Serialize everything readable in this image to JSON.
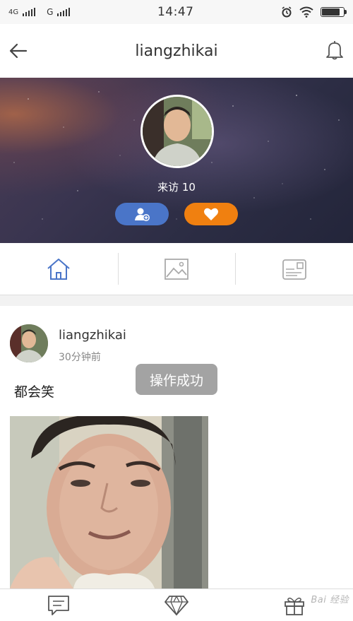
{
  "status_bar": {
    "network1": "4G",
    "network2": "G",
    "time": "14:47",
    "icons": [
      "signal-icon",
      "alarm-icon",
      "wifi-icon",
      "battery-icon"
    ],
    "battery_level": 0.85
  },
  "header": {
    "title": "liangzhikai",
    "left_icon": "back-arrow-icon",
    "right_icon": "bell-icon"
  },
  "profile": {
    "visits_label": "来访 10",
    "follow_icon": "add-friend-icon",
    "like_icon": "heart-icon",
    "follow_color": "#4a75c8",
    "like_color": "#f08010"
  },
  "tabs": [
    {
      "icon": "home-icon",
      "active": true
    },
    {
      "icon": "image-icon",
      "active": false
    },
    {
      "icon": "profile-card-icon",
      "active": false
    }
  ],
  "post": {
    "username": "liangzhikai",
    "time": "30分钟前",
    "text": "都会笑"
  },
  "toast": {
    "text": "操作成功"
  },
  "bottom_nav": [
    {
      "icon": "message-icon"
    },
    {
      "icon": "diamond-icon"
    },
    {
      "icon": "gift-icon"
    }
  ],
  "watermark": "Bai 经验"
}
